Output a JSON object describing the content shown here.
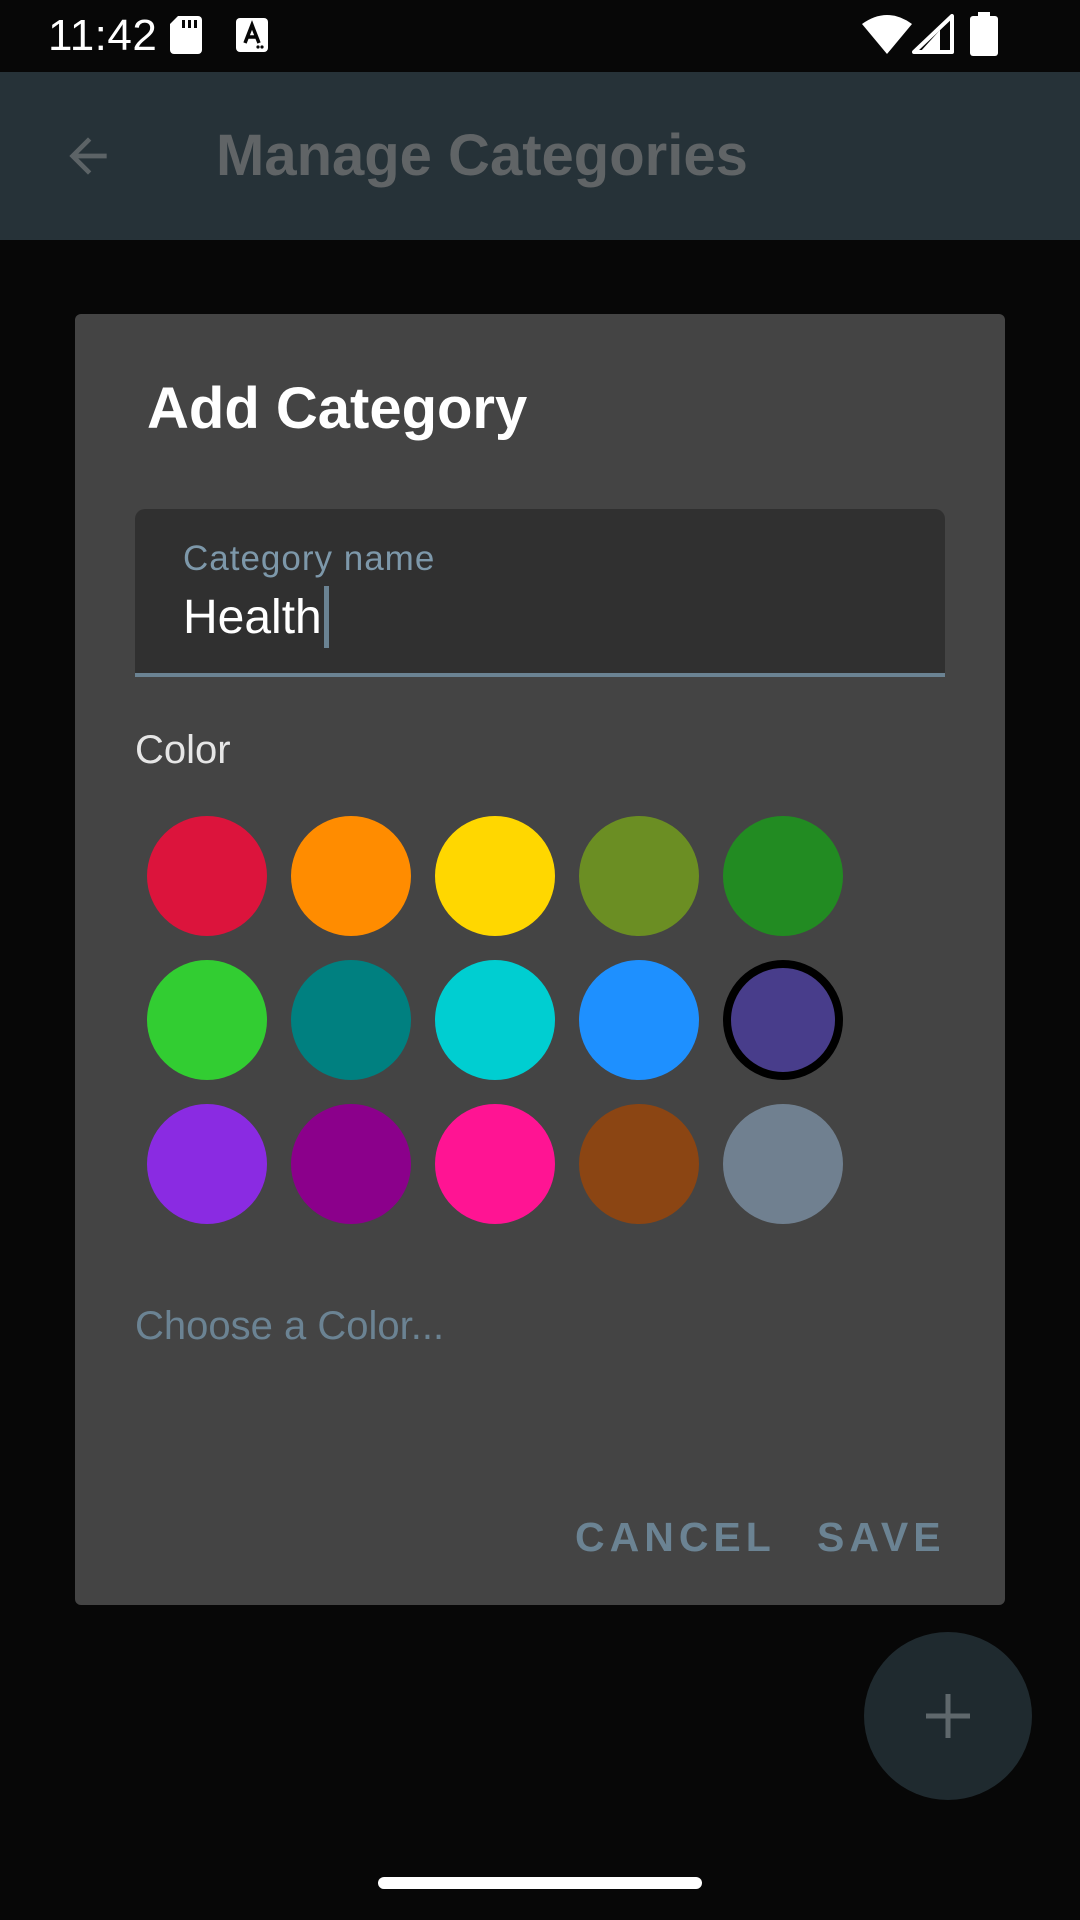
{
  "status_bar": {
    "time": "11:42",
    "icons": [
      "sd-card-icon",
      "keyboard-a-icon",
      "wifi-icon",
      "signal-icon",
      "battery-icon"
    ]
  },
  "app_bar": {
    "title": "Manage Categories",
    "back_icon": "arrow-back-icon"
  },
  "dialog": {
    "title": "Add Category",
    "field": {
      "label": "Category name",
      "value": "Health"
    },
    "color_label": "Color",
    "colors": [
      {
        "name": "crimson",
        "hex": "#DC143C",
        "selected": false
      },
      {
        "name": "dark-orange",
        "hex": "#FF8C00",
        "selected": false
      },
      {
        "name": "gold",
        "hex": "#FFD700",
        "selected": false
      },
      {
        "name": "olive-drab",
        "hex": "#6B8E23",
        "selected": false
      },
      {
        "name": "forest-green",
        "hex": "#228B22",
        "selected": false
      },
      {
        "name": "lime-green",
        "hex": "#32CD32",
        "selected": false
      },
      {
        "name": "teal",
        "hex": "#008080",
        "selected": false
      },
      {
        "name": "dark-turquoise",
        "hex": "#00CED1",
        "selected": false
      },
      {
        "name": "dodger-blue",
        "hex": "#1E90FF",
        "selected": false
      },
      {
        "name": "dark-slate-blue",
        "hex": "#483D8B",
        "selected": true
      },
      {
        "name": "blue-violet",
        "hex": "#8A2BE2",
        "selected": false
      },
      {
        "name": "dark-magenta",
        "hex": "#8B008B",
        "selected": false
      },
      {
        "name": "deep-pink",
        "hex": "#FF1493",
        "selected": false
      },
      {
        "name": "saddle-brown",
        "hex": "#8B4513",
        "selected": false
      },
      {
        "name": "slate-gray",
        "hex": "#708090",
        "selected": false
      }
    ],
    "choose_color_link": "Choose a Color...",
    "cancel_label": "CANCEL",
    "save_label": "SAVE"
  },
  "fab": {
    "icon": "plus-icon"
  },
  "theme": {
    "accent": "#6B8393",
    "dialog_bg": "#444444",
    "app_bar_bg": "#263238"
  }
}
